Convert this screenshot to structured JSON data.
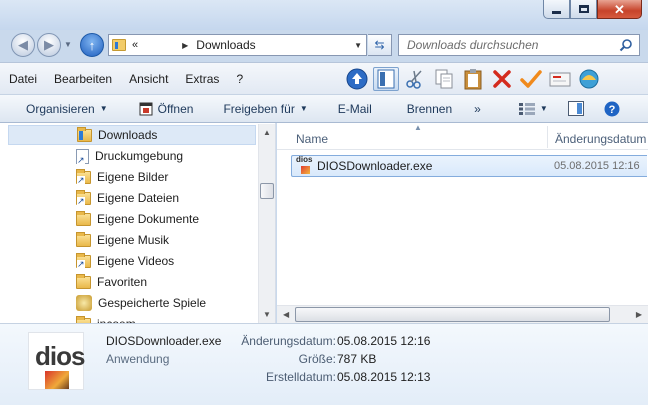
{
  "window": {
    "controls": {
      "minimize": "minimize",
      "maximize": "maximize",
      "close": "close"
    }
  },
  "address": {
    "prefix": "«",
    "path": "Downloads",
    "search_placeholder": "Downloads durchsuchen"
  },
  "menu": [
    "Datei",
    "Bearbeiten",
    "Ansicht",
    "Extras",
    "?"
  ],
  "menu_tools": [
    "up-arrow-icon",
    "preview-pane-icon",
    "cut-icon",
    "copy-icon",
    "paste-icon",
    "delete-icon",
    "checkmark-icon",
    "mail-icon",
    "shell-icon"
  ],
  "toolbar": {
    "organize": "Organisieren",
    "open": "Öffnen",
    "share": "Freigeben für",
    "email": "E-Mail",
    "burn": "Brennen",
    "more": "»"
  },
  "nav_tree": [
    {
      "label": "Downloads",
      "icon": "folder-icon",
      "selected": true
    },
    {
      "label": "Druckumgebung",
      "icon": "shortcut-icon"
    },
    {
      "label": "Eigene Bilder",
      "icon": "folder-link-icon"
    },
    {
      "label": "Eigene Dateien",
      "icon": "folder-link-icon"
    },
    {
      "label": "Eigene Dokumente",
      "icon": "folder-icon"
    },
    {
      "label": "Eigene Musik",
      "icon": "folder-icon"
    },
    {
      "label": "Eigene Videos",
      "icon": "folder-link-icon"
    },
    {
      "label": "Favoriten",
      "icon": "star-folder-icon"
    },
    {
      "label": "Gespeicherte Spiele",
      "icon": "games-icon"
    },
    {
      "label": "incoem",
      "icon": "folder-icon"
    }
  ],
  "columns": {
    "name": "Name",
    "date": "Änderungsdatum"
  },
  "files": [
    {
      "name": "DIOSDownloader.exe",
      "date": "05.08.2015 12:16",
      "icon_text": "dios"
    }
  ],
  "details": {
    "icon_text": "dios",
    "name": "DIOSDownloader.exe",
    "type": "Anwendung",
    "modified_label": "Änderungsdatum:",
    "modified": "05.08.2015 12:16",
    "size_label": "Größe:",
    "size": "787 KB",
    "created_label": "Erstelldatum:",
    "created": "05.08.2015 12:13"
  }
}
